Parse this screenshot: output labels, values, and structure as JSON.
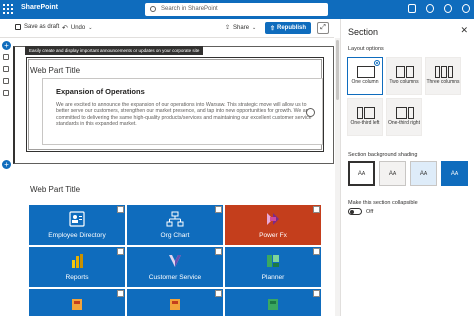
{
  "app": {
    "name": "SharePoint"
  },
  "search": {
    "placeholder": "Search in SharePoint"
  },
  "toolbar": {
    "save_draft": "Save as draft",
    "undo": "Undo",
    "share": "Share",
    "republish": "Republish"
  },
  "canvas": {
    "tooltip": "Easily create and display important announcements or updates on your corporate site",
    "webpart1_title": "Web Part Title",
    "announcement_heading": "Expansion of Operations",
    "announcement_body": "We are excited to announce the expansion of our operations into Warsaw. This strategic move will allow us to better serve our customers, strengthen our market presence, and tap into new opportunities for growth. We are committed to delivering the same high-quality products/services and maintaining our excellent customer service standards in this expanded market.",
    "webpart2_title": "Web Part Title"
  },
  "tiles": [
    {
      "label": "Employee Directory",
      "icon": "people-card-icon",
      "color": "#0f6cbd"
    },
    {
      "label": "Org Chart",
      "icon": "org-chart-icon",
      "color": "#0f6cbd"
    },
    {
      "label": "Power Fx",
      "icon": "power-fx-icon",
      "color": "#c43e1c"
    },
    {
      "label": "Reports",
      "icon": "reports-icon",
      "color": "#0f6cbd"
    },
    {
      "label": "Customer Service",
      "icon": "customer-service-icon",
      "color": "#0f6cbd"
    },
    {
      "label": "Planner",
      "icon": "planner-icon",
      "color": "#0f6cbd"
    },
    {
      "label": "",
      "icon": "app-icon",
      "color": "#0f6cbd"
    },
    {
      "label": "",
      "icon": "app-icon",
      "color": "#0f6cbd"
    },
    {
      "label": "",
      "icon": "app-icon",
      "color": "#0f6cbd"
    }
  ],
  "panel": {
    "title": "Section",
    "layout_options_label": "Layout options",
    "layouts": [
      {
        "label": "One column",
        "selected": true
      },
      {
        "label": "Two columns",
        "selected": false
      },
      {
        "label": "Three columns",
        "selected": false
      },
      {
        "label": "One-third left",
        "selected": false
      },
      {
        "label": "One-third right",
        "selected": false
      }
    ],
    "shading_label": "Section background shading",
    "shades": [
      {
        "glyph": "A",
        "color": "#ffffff"
      },
      {
        "glyph": "A",
        "color": "#f3f2f1"
      },
      {
        "glyph": "A",
        "color": "#deecf9"
      },
      {
        "glyph": "A",
        "color": "#0f6cbd"
      }
    ],
    "collapsible_label": "Make this section collapsible",
    "toggle_state": "Off"
  },
  "colors": {
    "accent": "#0f6cbd",
    "accent_orange": "#c43e1c"
  }
}
